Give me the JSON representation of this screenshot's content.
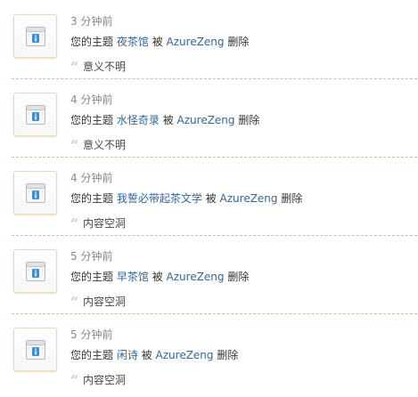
{
  "notifications": [
    {
      "time": "3 分钟前",
      "prefix": "您的主题",
      "topic": "夜茶馆",
      "by": "被",
      "user": "AzureZeng",
      "action": "删除",
      "reason": "意义不明"
    },
    {
      "time": "4 分钟前",
      "prefix": "您的主题",
      "topic": "水怪奇录",
      "by": "被",
      "user": "AzureZeng",
      "action": "删除",
      "reason": "意义不明"
    },
    {
      "time": "4 分钟前",
      "prefix": "您的主题",
      "topic": "我誓必带起茶文学",
      "by": "被",
      "user": "AzureZeng",
      "action": "删除",
      "reason": "内容空洞"
    },
    {
      "time": "5 分钟前",
      "prefix": "您的主题",
      "topic": "早茶馆",
      "by": "被",
      "user": "AzureZeng",
      "action": "删除",
      "reason": "内容空洞"
    },
    {
      "time": "5 分钟前",
      "prefix": "您的主题",
      "topic": "闲诗",
      "by": "被",
      "user": "AzureZeng",
      "action": "删除",
      "reason": "内容空洞"
    }
  ],
  "icons": {
    "notice": "system-notice-icon",
    "quote": "quote-mark-icon"
  },
  "colors": {
    "link": "#336699",
    "divider": "#e4b98a",
    "time": "#888888",
    "icon_blue": "#3a8fd6"
  }
}
